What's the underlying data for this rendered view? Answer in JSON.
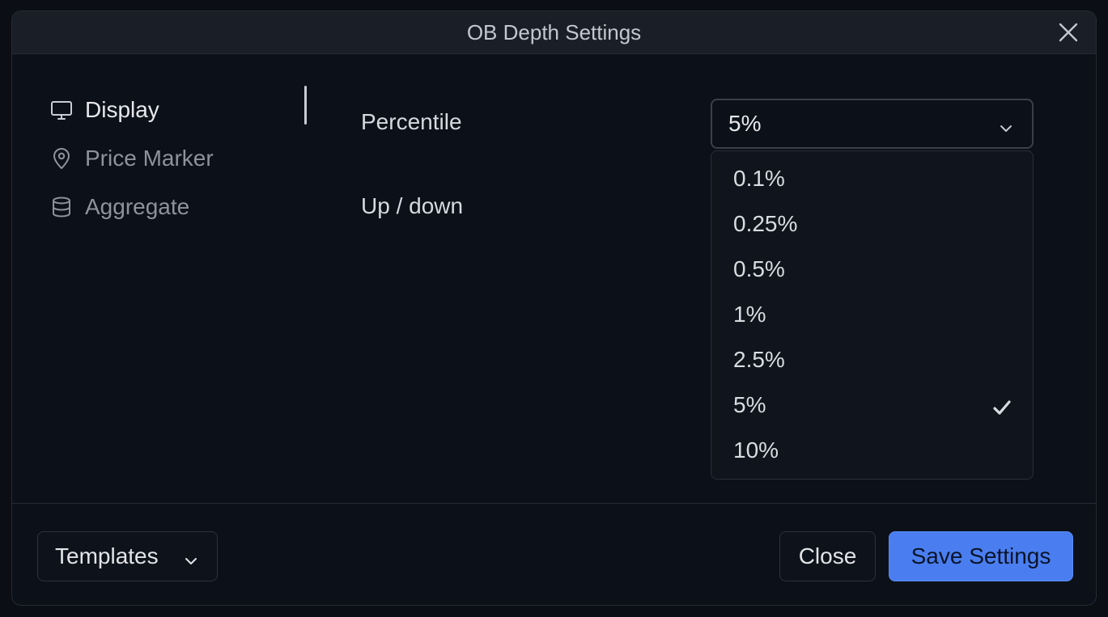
{
  "dialog": {
    "title": "OB Depth Settings"
  },
  "nav": {
    "items": [
      {
        "label": "Display",
        "icon": "monitor-icon",
        "active": true
      },
      {
        "label": "Price Marker",
        "icon": "map-pin-icon",
        "active": false
      },
      {
        "label": "Aggregate",
        "icon": "database-icon",
        "active": false
      }
    ]
  },
  "settings": {
    "percentile_label": "Percentile",
    "updown_label": "Up / down",
    "percentile_value": "5%",
    "options": [
      "0.1%",
      "0.25%",
      "0.5%",
      "1%",
      "2.5%",
      "5%",
      "10%"
    ],
    "selected_option": "5%"
  },
  "footer": {
    "templates_label": "Templates",
    "close_label": "Close",
    "save_label": "Save Settings"
  },
  "colors": {
    "accent": "#4a7ef0",
    "background": "#0c1018",
    "titlebar": "#1a1e26"
  }
}
